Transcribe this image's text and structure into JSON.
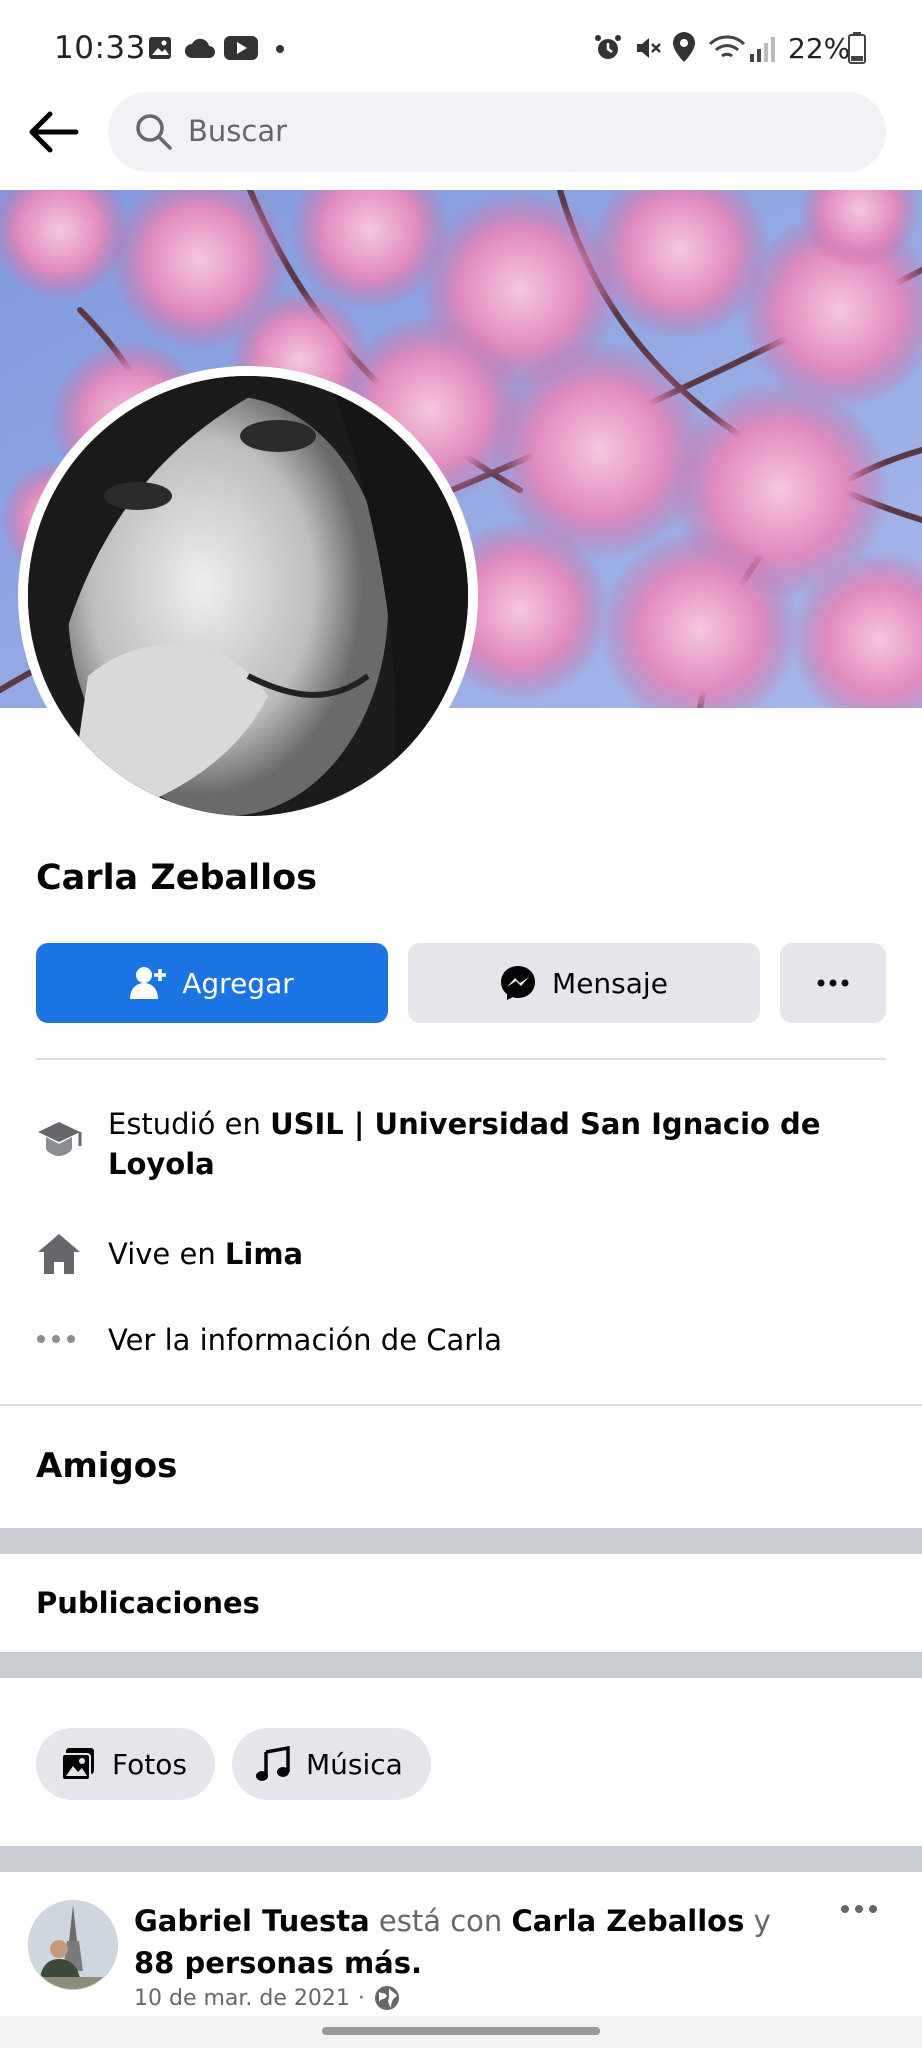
{
  "status_bar": {
    "time": "10:33",
    "battery": "22%",
    "left_icons": [
      "image-icon",
      "cloud-icon",
      "youtube-icon",
      "dot-icon"
    ],
    "right_icons": [
      "alarm-icon",
      "mute-icon",
      "location-icon",
      "wifi-icon",
      "signal-icon",
      "battery-icon"
    ]
  },
  "header": {
    "search_placeholder": "Buscar"
  },
  "profile": {
    "name": "Carla Zeballos"
  },
  "actions": {
    "add_label": "Agregar",
    "message_label": "Mensaje"
  },
  "info": {
    "study_prefix": "Estudió en ",
    "study_place": "USIL | Universidad San Ignacio de Loyola",
    "lives_prefix": "Vive en ",
    "lives_place": "Lima",
    "see_more": "Ver la información de Carla"
  },
  "sections": {
    "friends": "Amigos",
    "posts": "Publicaciones"
  },
  "chips": {
    "photos": "Fotos",
    "music": "Música"
  },
  "post": {
    "author": "Gabriel Tuesta",
    "with_text": " está con ",
    "tagged": "Carla Zeballos",
    "and_text": " y ",
    "others": "88 personas más.",
    "date": "10 de mar. de 2021",
    "separator": "·"
  },
  "colors": {
    "primary": "#1b74e4",
    "button_gray": "#e4e6eb",
    "search_bg": "#f0f2f5",
    "muted_text": "#65676b",
    "cover_pink": "#e08bbd",
    "cover_sky": "#8fa6e0"
  }
}
